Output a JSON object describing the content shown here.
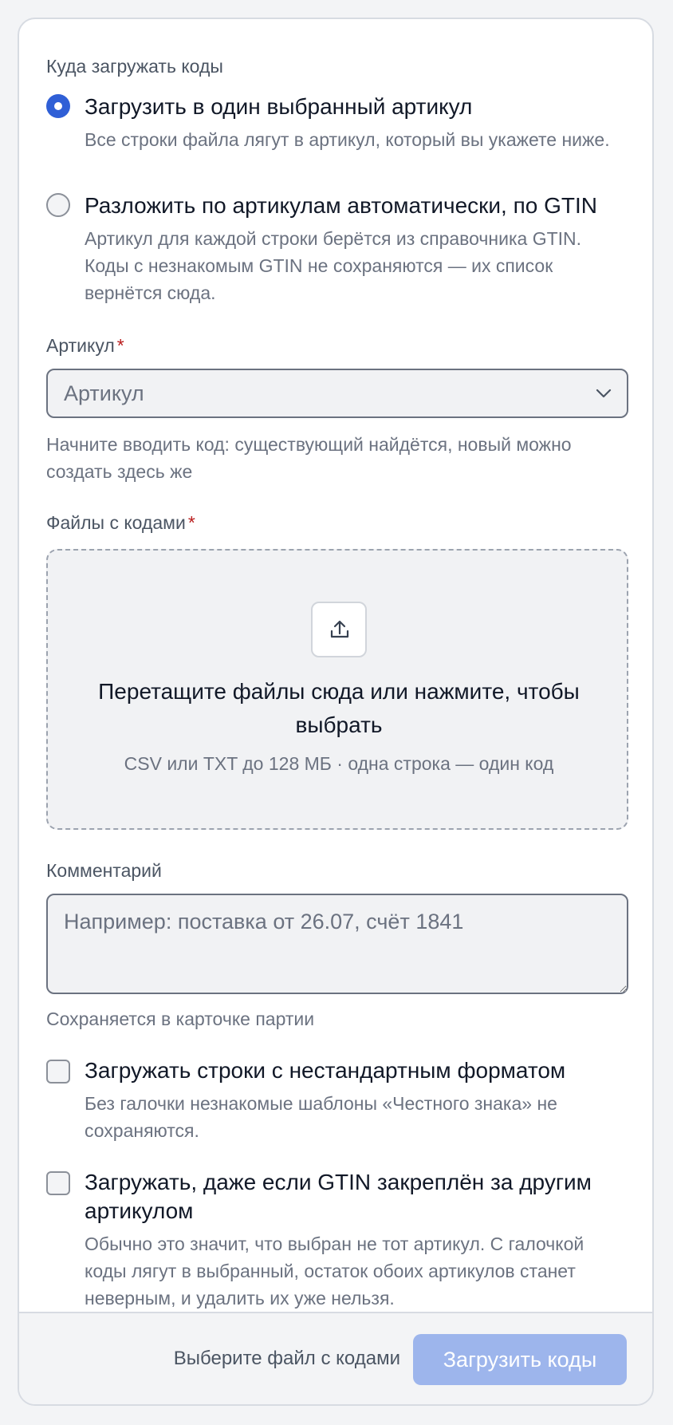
{
  "target": {
    "label": "Куда загружать коды",
    "options": [
      {
        "title": "Загрузить в один выбранный артикул",
        "description": "Все строки файла лягут в артикул, который вы укажете ниже.",
        "selected": true
      },
      {
        "title": "Разложить по артикулам автоматически, по GTIN",
        "description": "Артикул для каждой строки берётся из справочника GTIN. Коды с незнакомым GTIN не сохраняются — их список вернётся сюда.",
        "selected": false
      }
    ]
  },
  "article": {
    "label": "Артикул",
    "required_mark": "*",
    "placeholder": "Артикул",
    "hint": "Начните вводить код: существующий найдётся, новый можно создать здесь же"
  },
  "files": {
    "label": "Файлы с кодами",
    "required_mark": "*",
    "drop_title": "Перетащите файлы сюда или нажмите, чтобы выбрать",
    "drop_hint": "CSV или TXT до 128 МБ · одна строка — один код",
    "icon": "upload-icon"
  },
  "comment": {
    "label": "Комментарий",
    "placeholder": "Например: поставка от 26.07, счёт 1841",
    "value": "",
    "hint": "Сохраняется в карточке партии"
  },
  "options": [
    {
      "title": "Загружать строки с нестандартным форматом",
      "description": "Без галочки незнакомые шаблоны «Честного знака» не сохраняются.",
      "checked": false
    },
    {
      "title": "Загружать, даже если GTIN закреплён за другим артикулом",
      "description": "Обычно это значит, что выбран не тот артикул. С галочкой коды лягут в выбранный, остаток обоих артикулов станет неверным, и удалить их уже нельзя.",
      "checked": false
    }
  ],
  "footer": {
    "status": "Выберите файл с кодами",
    "submit_label": "Загрузить коды",
    "submit_disabled": true
  },
  "colors": {
    "accent": "#2f5fd6",
    "submit_disabled": "#9db5ec",
    "required": "#b91c1c"
  }
}
